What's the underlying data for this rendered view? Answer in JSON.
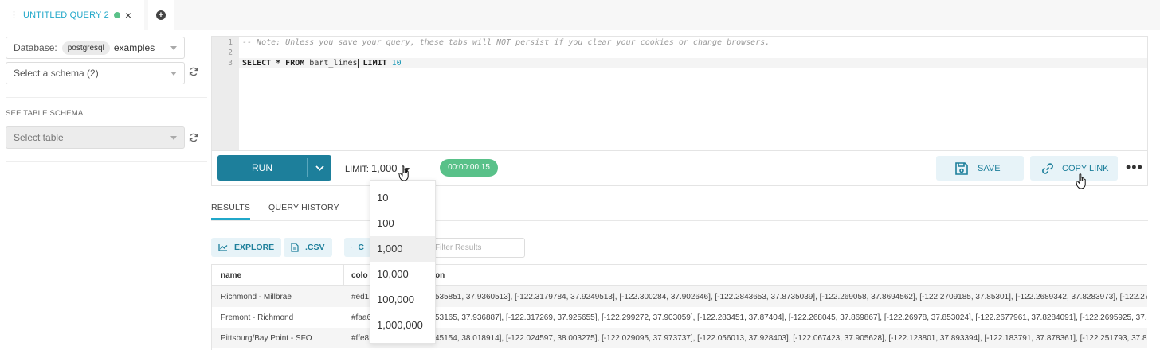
{
  "tabs": {
    "active_title": "UNTITLED QUERY 2",
    "close_glyph": "×",
    "add_glyph": "+"
  },
  "sidebar": {
    "database_label": "Database:",
    "database_engine": "postgresql",
    "database_name": "examples",
    "schema_placeholder": "Select a schema (2)",
    "table_schema_heading": "SEE TABLE SCHEMA",
    "table_placeholder": "Select table"
  },
  "editor": {
    "line_numbers": [
      "1",
      "2",
      "3"
    ],
    "line1": "-- Note: Unless you save your query, these tabs will NOT persist if you clear your cookies or change browsers.",
    "line3_kw1": "SELECT * FROM",
    "line3_table": " bart_lines",
    "line3_kw2": " LIMIT",
    "line3_num": " 10"
  },
  "toolbar": {
    "run_label": "RUN",
    "limit_label": "LIMIT:",
    "limit_value": "1,000",
    "timer": "00:00:00:15",
    "save_label": "SAVE",
    "copy_link_label": "COPY LINK",
    "more_glyph": "•••"
  },
  "limit_options": [
    "10",
    "100",
    "1,000",
    "10,000",
    "100,000",
    "1,000,000"
  ],
  "results": {
    "tab_results": "RESULTS",
    "tab_history": "QUERY HISTORY",
    "explore_label": "EXPLORE",
    "csv_label": ".CSV",
    "copy_label_partial": "C",
    "filter_placeholder": "Filter Results",
    "columns": [
      "name",
      "colo",
      "on"
    ],
    "rows": [
      {
        "name": "Richmond - Millbrae",
        "color": "#ed1",
        "path": "535851, 37.9360513], [-122.3179784, 37.9249513], [-122.300284, 37.902646], [-122.2843653, 37.8735039], [-122.269058, 37.8694562], [-122.2709185, 37.85301], [-122.2689342, 37.8283973], [-122.27"
      },
      {
        "name": "Fremont - Richmond",
        "color": "#faa6",
        "path": "53165, 37.936887], [-122.317269, 37.925655], [-122.299272, 37.903059], [-122.283451, 37.87404], [-122.268045, 37.869867], [-122.26978, 37.853024], [-122.2677961, 37.8284091], [-122.2695925, 37.8"
      },
      {
        "name": "Pittsburg/Bay Point - SFO",
        "color": "#ffe8",
        "path": "45154, 38.018914], [-122.024597, 38.003275], [-122.029095, 37.973737], [-122.056013, 37.928403], [-122.067423, 37.905628], [-122.123801, 37.893394], [-122.183791, 37.878361], [-122.251793, 37.8"
      }
    ]
  },
  "colors": {
    "accent": "#20a7c9",
    "run_button": "#1d7f9b",
    "timer_green": "#59c189",
    "light_button": "#e7f3f8"
  }
}
